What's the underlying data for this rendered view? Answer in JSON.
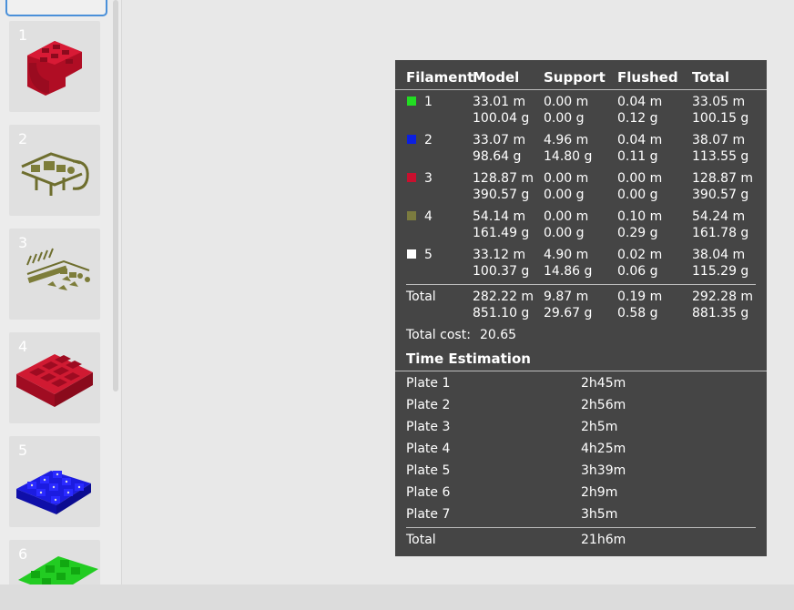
{
  "plates": [
    {
      "label": "1",
      "color": "#c8102e"
    },
    {
      "label": "2",
      "color": "#7a7a3a"
    },
    {
      "label": "3",
      "color": "#7a7a3a"
    },
    {
      "label": "4",
      "color": "#c8102e"
    },
    {
      "label": "5",
      "color": "#1515cc"
    },
    {
      "label": "6",
      "color": "#22cc22"
    }
  ],
  "filament_table": {
    "headers": {
      "filament": "Filament",
      "model": "Model",
      "support": "Support",
      "flushed": "Flushed",
      "total": "Total"
    },
    "rows": [
      {
        "id": "1",
        "color": "#22dd22",
        "model": [
          "33.01 m",
          "100.04 g"
        ],
        "support": [
          "0.00 m",
          "0.00 g"
        ],
        "flushed": [
          "0.04 m",
          "0.12 g"
        ],
        "total": [
          "33.05 m",
          "100.15 g"
        ]
      },
      {
        "id": "2",
        "color": "#0b1fe0",
        "model": [
          "33.07 m",
          "98.64 g"
        ],
        "support": [
          "4.96 m",
          "14.80 g"
        ],
        "flushed": [
          "0.04 m",
          "0.11 g"
        ],
        "total": [
          "38.07 m",
          "113.55 g"
        ]
      },
      {
        "id": "3",
        "color": "#c8102e",
        "model": [
          "128.87 m",
          "390.57 g"
        ],
        "support": [
          "0.00 m",
          "0.00 g"
        ],
        "flushed": [
          "0.00 m",
          "0.00 g"
        ],
        "total": [
          "128.87 m",
          "390.57 g"
        ]
      },
      {
        "id": "4",
        "color": "#7b7b3f",
        "model": [
          "54.14 m",
          "161.49 g"
        ],
        "support": [
          "0.00 m",
          "0.00 g"
        ],
        "flushed": [
          "0.10 m",
          "0.29 g"
        ],
        "total": [
          "54.24 m",
          "161.78 g"
        ]
      },
      {
        "id": "5",
        "color": "#ffffff",
        "model": [
          "33.12 m",
          "100.37 g"
        ],
        "support": [
          "4.90 m",
          "14.86 g"
        ],
        "flushed": [
          "0.02 m",
          "0.06 g"
        ],
        "total": [
          "38.04 m",
          "115.29 g"
        ]
      }
    ],
    "total_row": {
      "label": "Total",
      "model": [
        "282.22 m",
        "851.10 g"
      ],
      "support": [
        "9.87 m",
        "29.67 g"
      ],
      "flushed": [
        "0.19 m",
        "0.58 g"
      ],
      "total": [
        "292.28 m",
        "881.35 g"
      ]
    }
  },
  "total_cost": {
    "label": "Total cost:",
    "value": "20.65"
  },
  "time_estimation": {
    "title": "Time Estimation",
    "plates": [
      {
        "label": "Plate 1",
        "time": "2h45m"
      },
      {
        "label": "Plate 2",
        "time": "2h56m"
      },
      {
        "label": "Plate 3",
        "time": "2h5m"
      },
      {
        "label": "Plate 4",
        "time": "4h25m"
      },
      {
        "label": "Plate 5",
        "time": "3h39m"
      },
      {
        "label": "Plate 6",
        "time": "2h9m"
      },
      {
        "label": "Plate 7",
        "time": "3h5m"
      }
    ],
    "total": {
      "label": "Total",
      "time": "21h6m"
    }
  }
}
